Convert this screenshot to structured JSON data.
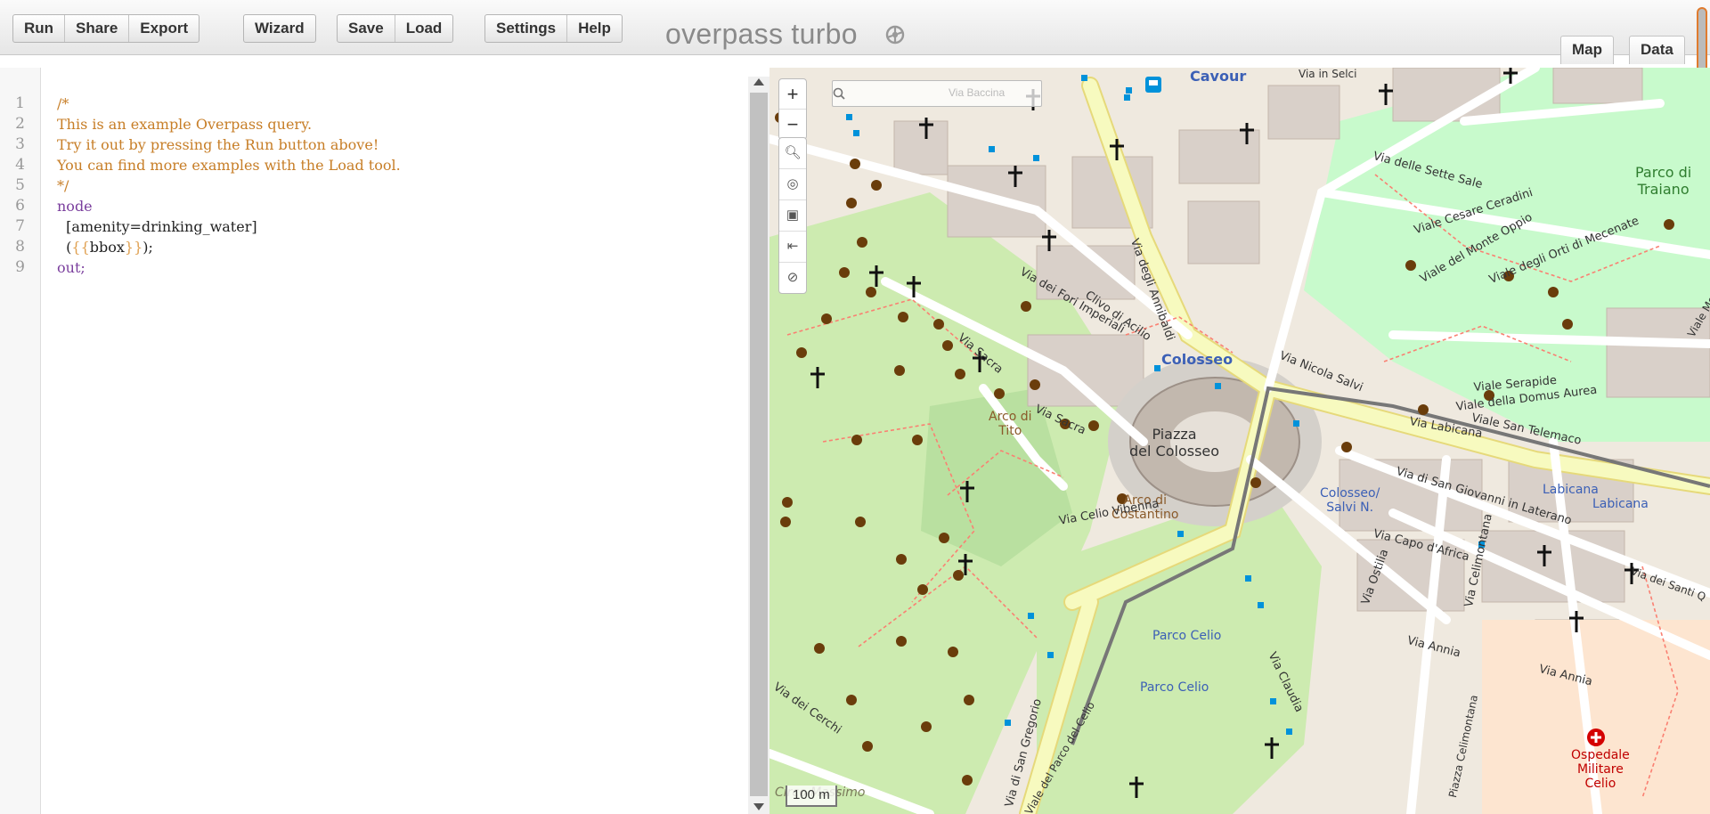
{
  "toolbar": {
    "groups": [
      [
        "Run",
        "Share",
        "Export"
      ],
      [
        "Wizard"
      ],
      [
        "Save",
        "Load"
      ],
      [
        "Settings",
        "Help"
      ]
    ],
    "brand": "overpass turbo",
    "brand_icon": "settings-gear-icon",
    "view_tabs": [
      "Map",
      "Data"
    ]
  },
  "editor": {
    "line_numbers": [
      "1",
      "2",
      "3",
      "4",
      "5",
      "6",
      "7",
      "8",
      "9"
    ],
    "lines": [
      "/*",
      "This is an example Overpass query.",
      "Try it out by pressing the Run button above!",
      "You can find more examples with the Load tool.",
      "*/",
      "node",
      "  [amenity=drinking_water]",
      "  ({{bbox}});",
      "out;"
    ],
    "colors": {
      "comment": "#c77e27",
      "keyword": "#7a3e9d",
      "template": "#e0a050"
    }
  },
  "map": {
    "controls": {
      "zoom_in": "+",
      "zoom_out": "−",
      "tools": [
        "zoom-to-data-icon",
        "locate-icon",
        "export-image-icon",
        "fit-bounds-icon",
        "clear-icon"
      ]
    },
    "scale": "100 m",
    "labels": {
      "cavour": "Cavour",
      "colosseo": "Colosseo",
      "piazza": "Piazza\ndel Colosseo",
      "arco_tito": "Arco di\nTito",
      "arco_costantino": "Arco di\nCostantino",
      "parco_traiano": "Parco di\nTraiano",
      "colosseo_salvi": "Colosseo/\nSalvi N.",
      "labicana1": "Labicana",
      "labicana2": "Labicana",
      "parco_celio1": "Parco Celio",
      "parco_celio2": "Parco Celio",
      "ospedale": "Ospedale\nMilitare\nCelio",
      "via_degli_annibaldi": "Via degli Annibaldi",
      "via_dei_fori": "Via dei Fori Imperiali",
      "clivo_acilio": "Clivo di Acilio",
      "via_sacra1": "Via Sacra",
      "via_sacra2": "Via Sacra",
      "via_nicola_salvi": "Via Nicola Salvi",
      "via_sette_sale": "Via delle Sette Sale",
      "viale_cesare_ceradini": "Viale Cesare Ceradini",
      "viale_monte_oppio": "Viale del Monte Oppio",
      "viale_orti": "Viale degli Orti di Mecenate",
      "viale_serapide": "Viale Serapide",
      "viale_domus": "Viale della Domus Aurea",
      "viale_telemaco": "Viale San Telemaco",
      "via_labicana": "Via Labicana",
      "via_san_giovanni": "Via di San Giovanni in Laterano",
      "via_celio_vibenna": "Via Celio Vibenna",
      "via_capo_africa": "Via Capo d'Africa",
      "via_ostilia": "Via Ostilia",
      "via_celimontana": "Via Celimontana",
      "via_annia1": "Via Annia",
      "via_annia2": "Via Annia",
      "via_claudia": "Via Claudia",
      "via_san_gregorio": "Via di San Gregorio",
      "viale_parco_celio": "Viale del Parco del Celio",
      "via_cerchi": "Via dei Cerchi",
      "circo_massimo": "Circo Massimo",
      "piazza_celimontana": "Piazza Celimontana",
      "via_in_selci": "Via in Selci",
      "via_santi": "Via dei Santi Q",
      "viale_mec": "Viale Mec",
      "via_baccina": "Via Baccina"
    },
    "colors": {
      "park": "#cdebb0",
      "garden": "#c8facc",
      "building": "#d9d0c9",
      "road_major": "#f7fabf",
      "road": "#ffffff",
      "water_poi": "#6a3d0b",
      "transit": "#0092da",
      "path": "#fa8072"
    }
  }
}
